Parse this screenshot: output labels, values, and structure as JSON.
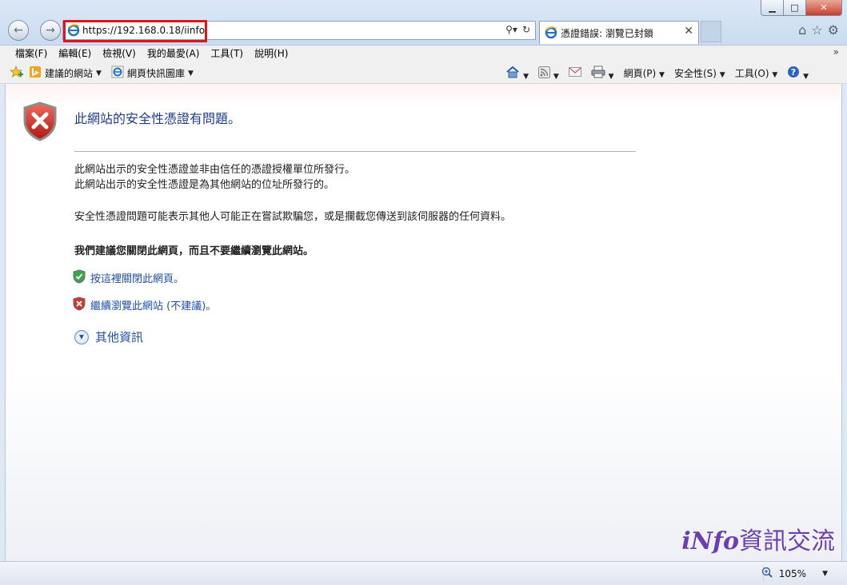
{
  "window": {
    "minimize_glyph": "▁",
    "maximize_glyph": "□",
    "close_glyph": "✕"
  },
  "nav": {
    "back_glyph": "←",
    "forward_glyph": "→"
  },
  "address_bar": {
    "url": "https://192.168.0.18/iinfo",
    "site_icon": "ie-icon",
    "search_icon": "search-icon",
    "refresh_icon": "refresh-icon"
  },
  "tab": {
    "title": "憑證錯誤: 瀏覽已封鎖",
    "close_glyph": "✕"
  },
  "chrome_icons": [
    "home-icon",
    "star-icon",
    "gear-icon"
  ],
  "menubar": {
    "items": [
      "檔案(F)",
      "編輯(E)",
      "檢視(V)",
      "我的最愛(A)",
      "工具(T)",
      "說明(H)"
    ],
    "overflow": "»"
  },
  "favorites_bar": {
    "items": [
      {
        "label": "建議的網站",
        "icon": "bing-icon"
      },
      {
        "label": "網頁快訊圖庫",
        "icon": "ie-icon"
      }
    ]
  },
  "command_bar": {
    "items": [
      "網頁(P)",
      "安全性(S)",
      "工具(O)"
    ]
  },
  "page": {
    "heading": "此網站的安全性憑證有問題。",
    "para1_line1": "此網站出示的安全性憑證並非由信任的憑證授權單位所發行。",
    "para1_line2": "此網站出示的安全性憑證是為其他網站的位址所發行的。",
    "para2": "安全性憑證問題可能表示其他人可能正在嘗試欺騙您，或是攔截您傳送到該伺服器的任何資料。",
    "recommendation": "我們建議您關閉此網頁，而且不要繼續瀏覽此網站。",
    "close_link": "按這裡關閉此網頁。",
    "continue_link": "繼續瀏覽此網站 (不建議)。",
    "more_info": "其他資訊"
  },
  "watermark": {
    "logo_text": "iNfo",
    "text": "資訊交流"
  },
  "status_bar": {
    "zoom": "105%"
  },
  "colors": {
    "link": "#1f4ea8",
    "heading": "#1f3d8a",
    "highlight_box": "#e0141b",
    "watermark": "#6b3fb0"
  }
}
